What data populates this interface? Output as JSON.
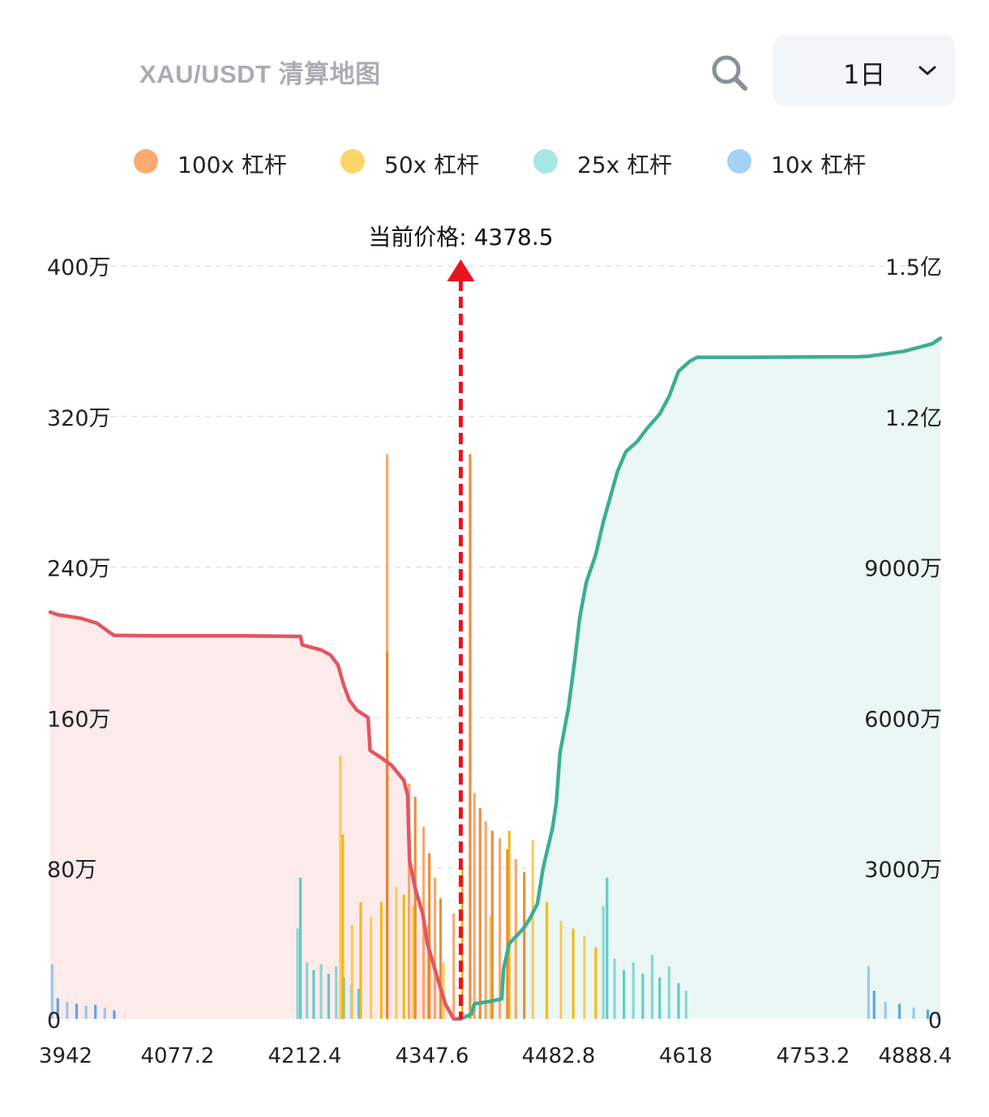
{
  "header": {
    "title": "XAU/USDT 清算地图",
    "period_value": "1日",
    "search_icon": "search-icon",
    "dropdown_icon": "chevron-down-icon"
  },
  "legend": [
    {
      "label": "100x 杠杆",
      "color": "#fbaa70"
    },
    {
      "label": "50x 杠杆",
      "color": "#fcd56a"
    },
    {
      "label": "25x 杠杆",
      "color": "#a8e6e3"
    },
    {
      "label": "10x 杠杆",
      "color": "#a3d2f7"
    }
  ],
  "chart_data": {
    "type": "bar",
    "x_ticks": [
      "3942",
      "4077.2",
      "4212.4",
      "4347.6",
      "4482.8",
      "4618",
      "4753.2",
      "4888.4"
    ],
    "xlim": [
      3942,
      4888.4
    ],
    "left_axis": {
      "ticks": [
        "0",
        "80万",
        "160万",
        "240万",
        "320万",
        "400万"
      ],
      "range": [
        0,
        4000000
      ]
    },
    "right_axis": {
      "ticks": [
        "0",
        "3000万",
        "6000万",
        "9000万",
        "1.2亿",
        "1.5亿"
      ],
      "range": [
        0,
        150000000
      ]
    },
    "grid": true,
    "current_price": {
      "label": "当前价格: 4378.5",
      "value": 4378.5
    },
    "colors": {
      "100x": "#f5a05f",
      "100x_dark": "#e8822a",
      "50x": "#f7c84a",
      "50x_dark": "#f4b400",
      "25x": "#7fd2d0",
      "25x_dark": "#4ec7c6",
      "10x": "#8fc3ef",
      "10x_dark": "#4f9be0",
      "long_line": "#e05760",
      "long_fill": "#fdeaea",
      "short_line": "#3cae93",
      "short_fill": "#ebf7f4",
      "arrow": "#e8131f"
    },
    "series": [
      {
        "name": "100x 杠杆",
        "values": [
          [
            4300.2,
            3000000
          ],
          [
            4300.2,
            1950000
          ],
          [
            4323.5,
            1250000
          ],
          [
            4330,
            1180000
          ],
          [
            4339,
            1020000
          ],
          [
            4345,
            880000
          ],
          [
            4351,
            750000
          ],
          [
            4357,
            640000
          ],
          [
            4371,
            560000
          ],
          [
            4388.4,
            3000000
          ],
          [
            4393,
            1200000
          ],
          [
            4399,
            1120000
          ],
          [
            4405,
            1050000
          ],
          [
            4412,
            1000000
          ],
          [
            4420,
            960000
          ],
          [
            4428,
            900000
          ],
          [
            4437,
            850000
          ],
          [
            4446,
            780000
          ]
        ]
      },
      {
        "name": "50x 杠杆",
        "values": [
          [
            4250.5,
            1400000
          ],
          [
            4253,
            980000
          ],
          [
            4263,
            500000
          ],
          [
            4272,
            620000
          ],
          [
            4283,
            540000
          ],
          [
            4294,
            620000
          ],
          [
            4310,
            700000
          ],
          [
            4318,
            660000
          ],
          [
            4328,
            600000
          ],
          [
            4344,
            500000
          ],
          [
            4360,
            300000
          ],
          [
            4380,
            800000
          ],
          [
            4410,
            550000
          ],
          [
            4430,
            1000000
          ],
          [
            4455,
            950000
          ],
          [
            4470,
            620000
          ],
          [
            4485,
            520000
          ],
          [
            4498,
            480000
          ],
          [
            4510,
            440000
          ],
          [
            4522,
            380000
          ]
        ]
      },
      {
        "name": "25x 杠杆",
        "values": [
          [
            4205,
            480000
          ],
          [
            4208,
            750000
          ],
          [
            4215,
            300000
          ],
          [
            4222,
            260000
          ],
          [
            4230,
            290000
          ],
          [
            4238,
            240000
          ],
          [
            4246,
            280000
          ],
          [
            4254,
            220000
          ],
          [
            4262,
            180000
          ],
          [
            4270,
            160000
          ],
          [
            4530,
            600000
          ],
          [
            4534,
            750000
          ],
          [
            4542,
            320000
          ],
          [
            4552,
            260000
          ],
          [
            4562,
            300000
          ],
          [
            4572,
            240000
          ],
          [
            4582,
            340000
          ],
          [
            4590,
            220000
          ],
          [
            4600,
            280000
          ],
          [
            4610,
            190000
          ],
          [
            4618,
            150000
          ]
        ]
      },
      {
        "name": "10x 杠杆",
        "values": [
          [
            3944,
            290000
          ],
          [
            3950,
            110000
          ],
          [
            3960,
            90000
          ],
          [
            3970,
            80000
          ],
          [
            3980,
            70000
          ],
          [
            3990,
            75000
          ],
          [
            4000,
            60000
          ],
          [
            4010,
            45000
          ],
          [
            4812,
            280000
          ],
          [
            4818,
            150000
          ],
          [
            4830,
            90000
          ],
          [
            4845,
            80000
          ],
          [
            4860,
            60000
          ],
          [
            4875,
            50000
          ],
          [
            4886,
            40000
          ]
        ]
      }
    ],
    "cumulative_long": {
      "name": "",
      "axis": "right",
      "values": [
        [
          3942,
          81000000
        ],
        [
          3950,
          80500000
        ],
        [
          3975,
          79800000
        ],
        [
          3992,
          78800000
        ],
        [
          4005,
          77000000
        ],
        [
          4010,
          76400000
        ],
        [
          4050,
          76300000
        ],
        [
          4100,
          76300000
        ],
        [
          4150,
          76300000
        ],
        [
          4208,
          76200000
        ],
        [
          4210,
          74500000
        ],
        [
          4230,
          73500000
        ],
        [
          4240,
          72500000
        ],
        [
          4248,
          70500000
        ],
        [
          4254,
          66500000
        ],
        [
          4260,
          63500000
        ],
        [
          4268,
          61500000
        ],
        [
          4276,
          60500000
        ],
        [
          4280,
          60000000
        ],
        [
          4282,
          53500000
        ],
        [
          4294,
          52000000
        ],
        [
          4305,
          50500000
        ],
        [
          4318,
          47500000
        ],
        [
          4322,
          44500000
        ],
        [
          4324,
          31500000
        ],
        [
          4330,
          26000000
        ],
        [
          4338,
          21000000
        ],
        [
          4343,
          15000000
        ],
        [
          4354,
          8000000
        ],
        [
          4362,
          3000000
        ],
        [
          4371,
          0
        ],
        [
          4378.5,
          0
        ]
      ]
    },
    "cumulative_short": {
      "name": "",
      "axis": "right",
      "values": [
        [
          4378.5,
          0
        ],
        [
          4390,
          1000000
        ],
        [
          4393,
          3000000
        ],
        [
          4410,
          3500000
        ],
        [
          4422,
          4000000
        ],
        [
          4424,
          10000000
        ],
        [
          4430,
          15000000
        ],
        [
          4445,
          18000000
        ],
        [
          4452,
          20000000
        ],
        [
          4460,
          23000000
        ],
        [
          4466,
          30000000
        ],
        [
          4476,
          38000000
        ],
        [
          4480,
          43000000
        ],
        [
          4484,
          53000000
        ],
        [
          4493,
          62000000
        ],
        [
          4500,
          72000000
        ],
        [
          4505,
          80000000
        ],
        [
          4512,
          87000000
        ],
        [
          4522,
          92500000
        ],
        [
          4530,
          99000000
        ],
        [
          4545,
          109000000
        ],
        [
          4554,
          113000000
        ],
        [
          4566,
          115000000
        ],
        [
          4576,
          117500000
        ],
        [
          4590,
          120500000
        ],
        [
          4600,
          124000000
        ],
        [
          4610,
          129000000
        ],
        [
          4622,
          131000000
        ],
        [
          4630,
          131800000
        ],
        [
          4690,
          131800000
        ],
        [
          4800,
          131900000
        ],
        [
          4812,
          132000000
        ],
        [
          4820,
          132200000
        ],
        [
          4850,
          133000000
        ],
        [
          4880,
          134500000
        ],
        [
          4888.4,
          135600000
        ]
      ]
    }
  }
}
